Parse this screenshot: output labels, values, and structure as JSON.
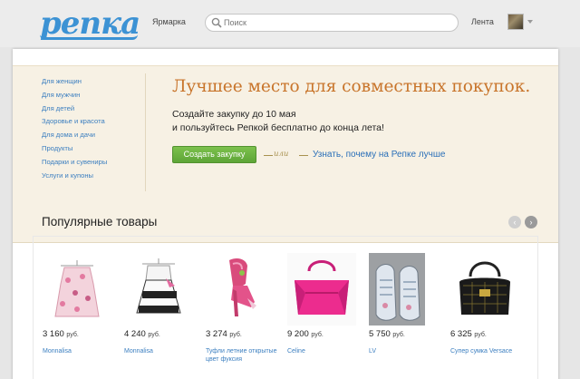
{
  "header": {
    "logo_text": "репка",
    "nav_market": "Ярмарка",
    "search_placeholder": "Поиск",
    "nav_feed": "Лента"
  },
  "categories": [
    "Для женщин",
    "Для мужчин",
    "Для детей",
    "Здоровье и красота",
    "Для дома и дачи",
    "Продукты",
    "Подарки и сувениры",
    "Услуги и купоны"
  ],
  "banner": {
    "headline": "Лучшее место для совместных покупок.",
    "promo_line1": "Создайте закупку до 10 мая",
    "promo_line2": "и пользуйтесь Репкой бесплатно до конца лета!",
    "create_button": "Создать закупку",
    "or_label": "или",
    "why_link": "Узнать, почему на Репке лучше"
  },
  "popular": {
    "title": "Популярные товары",
    "currency": "руб.",
    "products": [
      {
        "price": "3 160",
        "name": "Monnalisa",
        "icon": "pink-dress"
      },
      {
        "price": "4 240",
        "name": "Monnalisa",
        "icon": "black-white-dress"
      },
      {
        "price": "3 274",
        "name": "Туфли летние открытые цвет фуксия",
        "icon": "fuchsia-shoe"
      },
      {
        "price": "9 200",
        "name": "Celine",
        "icon": "pink-bag"
      },
      {
        "price": "5 750",
        "name": "LV",
        "icon": "sneakers"
      },
      {
        "price": "6 325",
        "name": "Супер сумка Versace",
        "icon": "black-bag"
      }
    ]
  },
  "colors": {
    "brand_blue": "#3c92d4",
    "headline_orange": "#c8742a",
    "button_green": "#6bb341",
    "link_blue": "#3c7fc0",
    "banner_bg": "#f7f1e4"
  }
}
